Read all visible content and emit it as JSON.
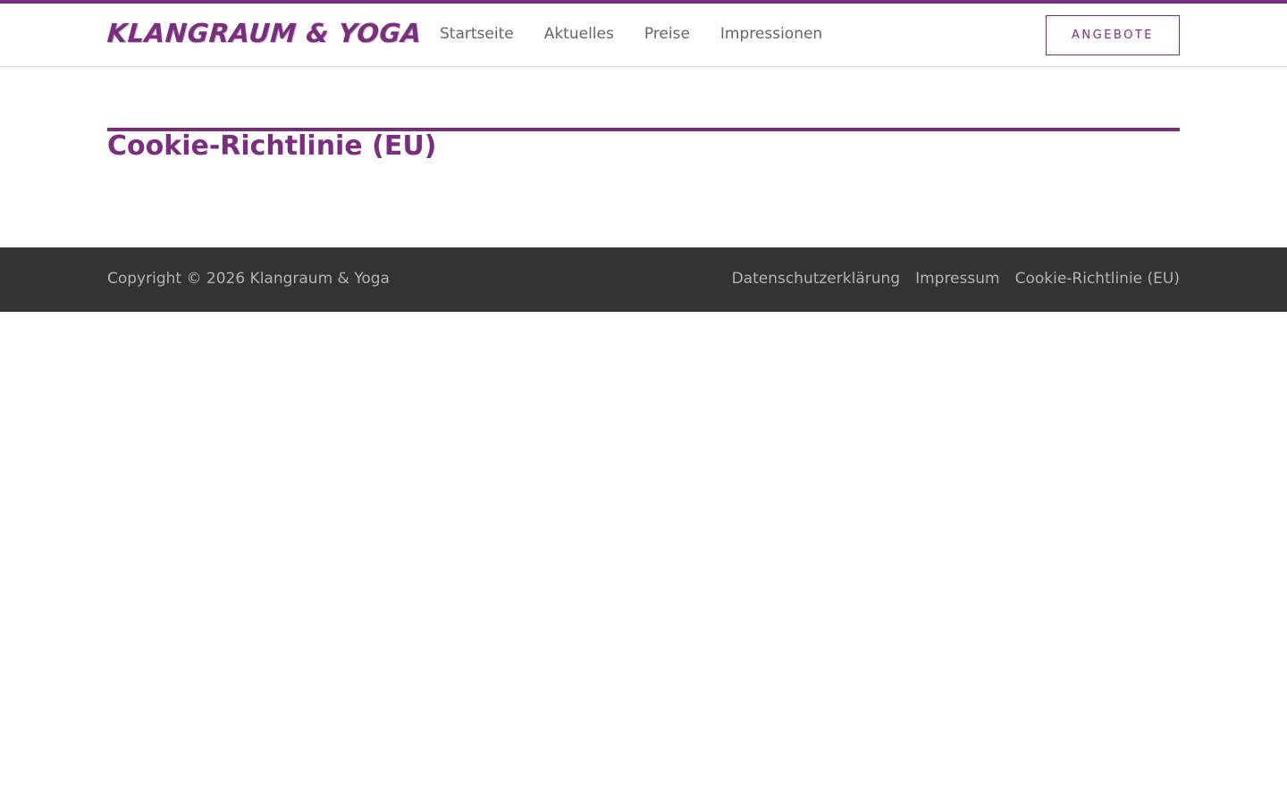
{
  "brand": {
    "logo_text": "Klangraum & Yoga",
    "accent_color": "#7b2d7f"
  },
  "nav": {
    "items": [
      {
        "label": "Startseite"
      },
      {
        "label": "Aktuelles"
      },
      {
        "label": "Preise"
      },
      {
        "label": "Impressionen"
      }
    ],
    "cta_label": "ANGEBOTE"
  },
  "main": {
    "title": "Cookie-Richtlinie (EU)"
  },
  "footer": {
    "copyright": "Copyright © 2026 Klangraum & Yoga",
    "links": [
      {
        "label": "Datenschutzerklärung"
      },
      {
        "label": "Impressum"
      },
      {
        "label": "Cookie-Richtlinie (EU)"
      }
    ],
    "background_color": "#333333"
  }
}
